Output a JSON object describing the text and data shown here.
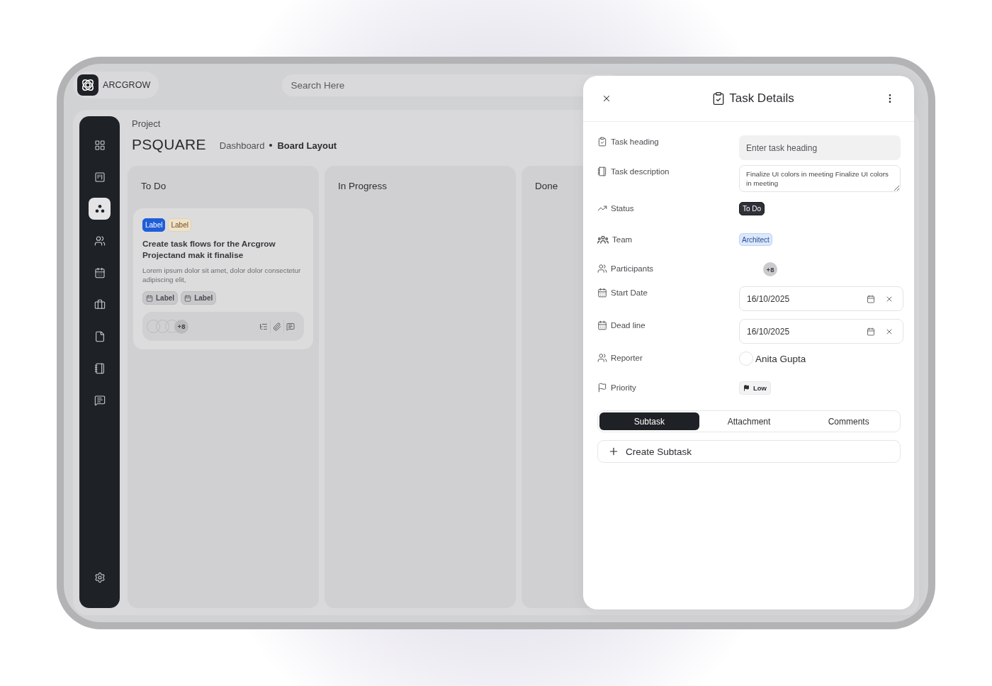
{
  "brand": {
    "name": "ARCGROW"
  },
  "search": {
    "placeholder": "Search Here"
  },
  "sidebar": {
    "items": [
      {
        "selected": false
      },
      {
        "selected": false
      },
      {
        "selected": true
      },
      {
        "selected": false
      },
      {
        "selected": false
      },
      {
        "selected": false
      },
      {
        "selected": false
      },
      {
        "selected": false
      },
      {
        "selected": false
      }
    ]
  },
  "page": {
    "eyebrow": "Project",
    "title": "PSQUARE",
    "breadcrumbs": [
      {
        "label": "Dashboard",
        "selected": false
      },
      {
        "label": "Board Layout",
        "selected": true
      }
    ]
  },
  "board": {
    "columns": [
      {
        "title": "To Do",
        "cards": [
          {
            "labels": [
              {
                "text": "Label",
                "kind": "solid",
                "color": "#1f5ed8"
              },
              {
                "text": "Label",
                "kind": "soft",
                "color": "#ede2ca"
              }
            ],
            "title": "Create task flows for the Arcgrow Projectand mak it finalise",
            "description": "Lorem ipsum dolor sit amet, dolor dolor consectetur adipiscing elit,",
            "tags": [
              "Label",
              "Label"
            ],
            "participants_more": "+8"
          }
        ]
      },
      {
        "title": "In Progress"
      },
      {
        "title": "Done"
      }
    ]
  },
  "task_panel": {
    "title": "Task Details",
    "fields": [
      {
        "kind": "input",
        "label": "Task heading",
        "placeholder": "Enter task heading"
      },
      {
        "kind": "textarea",
        "label": "Task description",
        "value": "Finalize UI colors in meeting Finalize UI colors in meeting"
      },
      {
        "kind": "status",
        "label": "Status",
        "value": "To Do"
      },
      {
        "kind": "team",
        "label": "Team",
        "value": "Architect"
      },
      {
        "kind": "participants",
        "label": "Participants",
        "more": "+8"
      },
      {
        "kind": "date",
        "label": "Start Date",
        "value": "16/10/2025"
      },
      {
        "kind": "date",
        "label": "Dead line",
        "value": "16/10/2025"
      },
      {
        "kind": "person",
        "label": "Reporter",
        "value": "Anita Gupta"
      },
      {
        "kind": "priority",
        "label": "Priority",
        "value": "Low"
      }
    ],
    "tabs": [
      {
        "label": "Subtask",
        "selected": true
      },
      {
        "label": "Attachment",
        "selected": false
      },
      {
        "label": "Comments",
        "selected": false
      }
    ],
    "create_button": "Create Subtask"
  }
}
